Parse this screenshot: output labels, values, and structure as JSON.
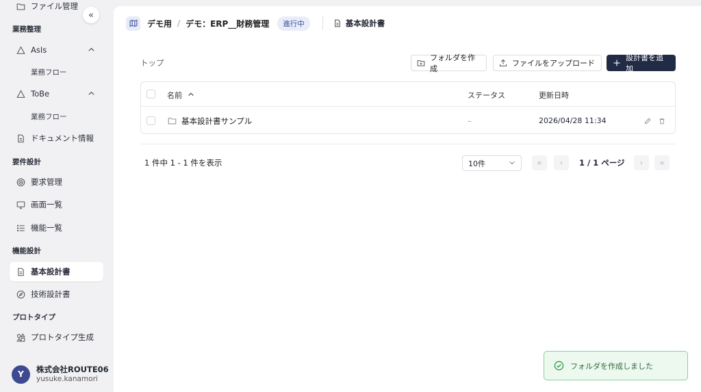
{
  "sidebar": {
    "top_item": "ファイル管理",
    "sections": {
      "business": "業務整理",
      "requirements": "要件設計",
      "functional": "機能設計",
      "prototype": "プロトタイプ"
    },
    "items": {
      "asis": "AsIs",
      "asis_flow": "業務フロー",
      "tobe": "ToBe",
      "tobe_flow": "業務フロー",
      "document_info": "ドキュメント情報",
      "requirements_mgmt": "要求管理",
      "screen_list": "画面一覧",
      "function_list": "機能一覧",
      "basic_design": "基本設計書",
      "tech_design": "技術設計書",
      "prototype_gen": "プロトタイプ生成"
    },
    "collapse_icon": "«"
  },
  "user": {
    "avatar_initial": "Y",
    "org": "株式会社ROUTE06",
    "name": "yusuke.kanamori"
  },
  "header": {
    "crumb_project": "デモ用",
    "crumb_sep": "/",
    "crumb_app": "デモ：ERP__財務管理",
    "status": "進行中",
    "doc_title": "基本設計書"
  },
  "toolbar": {
    "top_label": "トップ",
    "create_folder": "フォルダを作成",
    "upload_file": "ファイルをアップロード",
    "add_design": "設計書を追加"
  },
  "table": {
    "col_name": "名前",
    "sort_indicator": "^",
    "col_status": "ステータス",
    "col_updated": "更新日時",
    "rows": [
      {
        "name": "基本設計書サンプル",
        "status": "–",
        "updated": "2026/04/28 11:34"
      }
    ]
  },
  "pagination": {
    "count_text": "1 件中 1 - 1 件を表示",
    "per_page": "10件",
    "page_text": "1 / 1 ページ",
    "first": "«",
    "prev": "‹",
    "next": "›",
    "last": "»"
  },
  "toast": {
    "message": "フォルダを作成しました"
  },
  "colors": {
    "primary": "#222b45",
    "accent": "#3a4ea0",
    "success": "#2e9a45"
  }
}
